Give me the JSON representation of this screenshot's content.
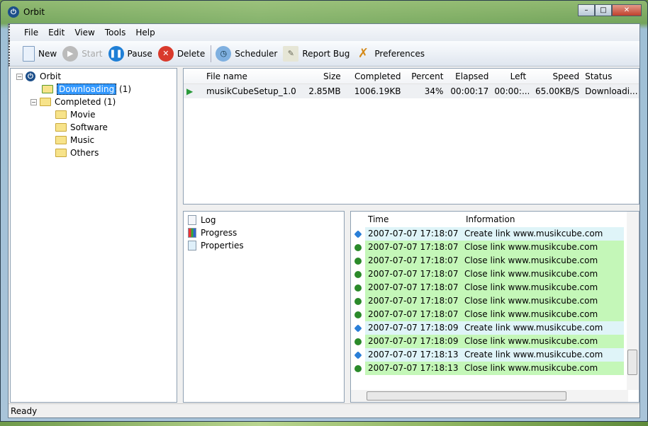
{
  "window": {
    "title": "Orbit"
  },
  "menu": [
    "File",
    "Edit",
    "View",
    "Tools",
    "Help"
  ],
  "toolbar": {
    "new": "New",
    "start": "Start",
    "pause": "Pause",
    "delete": "Delete",
    "scheduler": "Scheduler",
    "report_bug": "Report Bug",
    "preferences": "Preferences"
  },
  "tree": {
    "root": "Orbit",
    "downloading": "Downloading",
    "downloading_count": "(1)",
    "completed": "Completed",
    "completed_count": "(1)",
    "children": [
      "Movie",
      "Software",
      "Music",
      "Others"
    ]
  },
  "list": {
    "headers": [
      "File name",
      "Size",
      "Completed",
      "Percent",
      "Elapsed",
      "Left",
      "Speed",
      "Status"
    ],
    "rows": [
      [
        "musikCubeSetup_1.0...",
        "2.85MB",
        "1006.19KB",
        "34%",
        "00:00:17",
        "00:00:...",
        "65.00KB/S",
        "Downloadi..."
      ]
    ]
  },
  "views": [
    "Log",
    "Progress",
    "Properties"
  ],
  "log": {
    "headers": [
      "Time",
      "Information"
    ],
    "rows": [
      {
        "type": "create",
        "time": "2007-07-07 17:18:07",
        "info": "Create link www.musikcube.com"
      },
      {
        "type": "close",
        "time": "2007-07-07 17:18:07",
        "info": "Close link www.musikcube.com"
      },
      {
        "type": "close",
        "time": "2007-07-07 17:18:07",
        "info": "Close link www.musikcube.com"
      },
      {
        "type": "close",
        "time": "2007-07-07 17:18:07",
        "info": "Close link www.musikcube.com"
      },
      {
        "type": "close",
        "time": "2007-07-07 17:18:07",
        "info": "Close link www.musikcube.com"
      },
      {
        "type": "close",
        "time": "2007-07-07 17:18:07",
        "info": "Close link www.musikcube.com"
      },
      {
        "type": "close",
        "time": "2007-07-07 17:18:07",
        "info": "Close link www.musikcube.com"
      },
      {
        "type": "create",
        "time": "2007-07-07 17:18:09",
        "info": "Create link www.musikcube.com"
      },
      {
        "type": "close",
        "time": "2007-07-07 17:18:09",
        "info": "Close link www.musikcube.com"
      },
      {
        "type": "create",
        "time": "2007-07-07 17:18:13",
        "info": "Create link www.musikcube.com"
      },
      {
        "type": "close",
        "time": "2007-07-07 17:18:13",
        "info": "Close link www.musikcube.com"
      }
    ]
  },
  "colors": {
    "create_row": "#dff4f8",
    "close_row": "#c4f7b8"
  },
  "status": "Ready"
}
